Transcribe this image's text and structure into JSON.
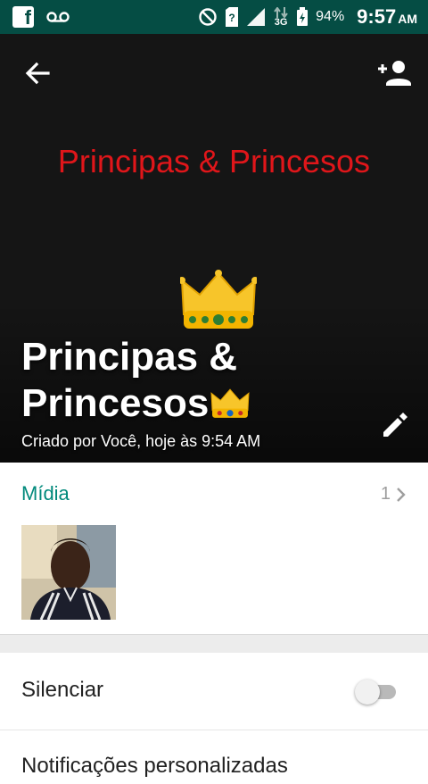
{
  "status_bar": {
    "battery_percent": "94%",
    "network": "3G",
    "time": "9:57",
    "ampm": "AM",
    "icons": [
      "facebook-icon",
      "voicemail-icon",
      "do-not-disturb-icon",
      "no-sim-icon",
      "signal-icon",
      "data-arrows-icon",
      "battery-charging-icon"
    ]
  },
  "header": {
    "banner_text": "Principas & Princesos",
    "group_name": "Principas & Princesos",
    "subtitle": "Criado por Você, hoje às 9:54 AM",
    "background_color": "#151515",
    "banner_color": "#e0161a"
  },
  "media": {
    "label": "Mídia",
    "count": "1",
    "accent_color": "#00897b"
  },
  "settings": {
    "mute_label": "Silenciar",
    "mute_enabled": false,
    "notifications_label": "Notificações personalizadas"
  }
}
